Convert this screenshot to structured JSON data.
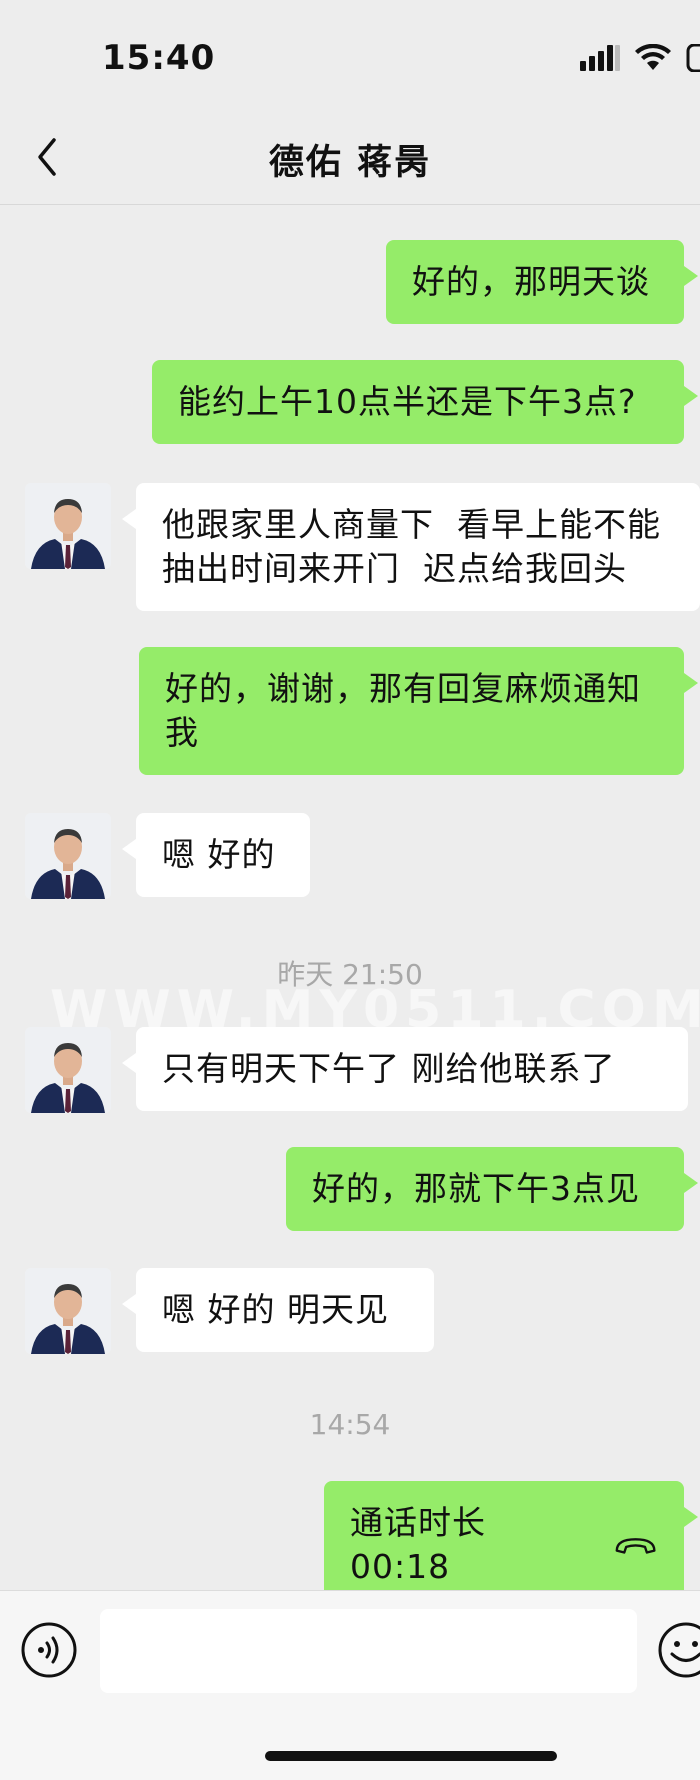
{
  "status_bar": {
    "time": "15:40",
    "icons": [
      "cellular-signal-icon",
      "wifi-icon",
      "battery-icon"
    ]
  },
  "nav": {
    "back_icon": "chevron-left-icon",
    "title": "德佑 蒋昺"
  },
  "watermark": "WWW.MY0511.COM",
  "messages": [
    {
      "sender": "me",
      "text": "好的，那明天谈"
    },
    {
      "sender": "me",
      "text": "能约上午10点半还是下午3点?"
    },
    {
      "sender": "them",
      "text": "他跟家里人商量下  看早上能不能抽出时间来开门  迟点给我回头"
    },
    {
      "sender": "me",
      "text": "好的，谢谢，那有回复麻烦通知我"
    },
    {
      "sender": "them",
      "text": "嗯 好的"
    },
    {
      "type": "time",
      "text": "昨天 21:50"
    },
    {
      "sender": "them",
      "text": "只有明天下午了 刚给他联系了"
    },
    {
      "sender": "me",
      "text": "好的，那就下午3点见"
    },
    {
      "sender": "them",
      "text": "嗯 好的 明天见"
    },
    {
      "type": "time",
      "text": "14:54"
    },
    {
      "sender": "me",
      "type": "call",
      "text": "通话时长 00:18",
      "icon": "phone-hangup-icon"
    }
  ],
  "input_bar": {
    "voice_icon": "voice-input-icon",
    "input_value": "",
    "emoji_icon": "emoji-icon"
  },
  "colors": {
    "background": "#ededed",
    "my_bubble": "#95ec69",
    "their_bubble": "#ffffff",
    "timestamp_text": "#a8a8a8"
  }
}
